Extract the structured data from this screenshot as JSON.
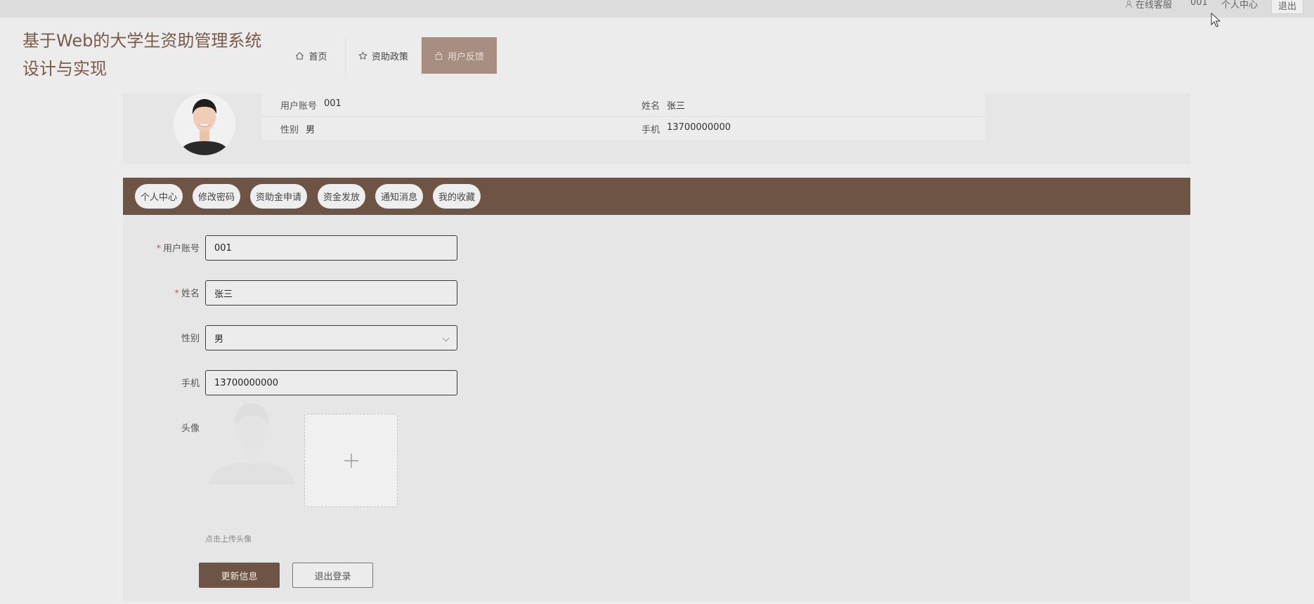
{
  "topbar": {
    "service": "在线客服",
    "user_id": "001",
    "center": "个人中心",
    "logout": "退出"
  },
  "site": {
    "title": "基于Web的大学生资助管理系统设计与实现"
  },
  "nav": {
    "items": [
      {
        "label": "首页",
        "icon": "home-icon"
      },
      {
        "label": "资助政策",
        "icon": "star-icon"
      },
      {
        "label": "用户反馈",
        "icon": "bag-icon",
        "active": true
      }
    ]
  },
  "profile": {
    "account_label": "用户账号",
    "account_value": "001",
    "name_label": "姓名",
    "name_value": "张三",
    "gender_label": "性别",
    "gender_value": "男",
    "phone_label": "手机",
    "phone_value": "13700000000"
  },
  "tabs": [
    "个人中心",
    "修改密码",
    "资助金申请",
    "资金发放",
    "通知消息",
    "我的收藏"
  ],
  "form": {
    "account": {
      "label": "用户账号",
      "value": "001"
    },
    "name": {
      "label": "姓名",
      "value": "张三"
    },
    "gender": {
      "label": "性别",
      "value": "男"
    },
    "phone": {
      "label": "手机",
      "value": "13700000000"
    },
    "avatar_label": "头像",
    "upload_hint": "点击上传头像",
    "submit": "更新信息",
    "logout": "退出登录"
  },
  "colors": {
    "brand": "#6e5444",
    "nav_active": "#a88e82",
    "title": "#7a5a49",
    "required": "#d9534f"
  }
}
